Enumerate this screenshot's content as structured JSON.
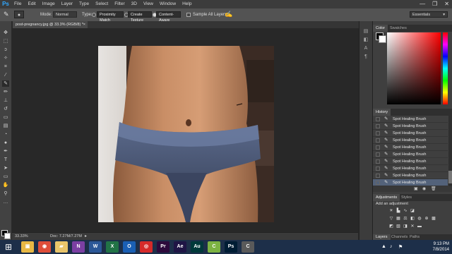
{
  "app": {
    "logo": "Ps"
  },
  "menubar": {
    "items": [
      "File",
      "Edit",
      "Image",
      "Layer",
      "Type",
      "Select",
      "Filter",
      "3D",
      "View",
      "Window",
      "Help"
    ],
    "controls": [
      "—",
      "❐",
      "✕"
    ]
  },
  "options": {
    "mode_label": "Mode:",
    "mode_value": "Normal",
    "type_label": "Type:",
    "btn_proximity": "Proximity Match",
    "btn_texture": "Create Texture",
    "btn_content": "Content-Aware",
    "sample_label": "Sample All Layers",
    "workspace": "Essentials"
  },
  "document": {
    "tab_title": "post-pregnancy.jpg @ 33.3% (RGB/8) *",
    "close": "×"
  },
  "status": {
    "zoom": "33.33%",
    "doc": "Doc: 7.27M/7.27M"
  },
  "color_panel": {
    "tabs": [
      "Color",
      "Swatches"
    ]
  },
  "history_panel": {
    "title": "History",
    "items": [
      "Spot Healing Brush",
      "Spot Healing Brush",
      "Spot Healing Brush",
      "Spot Healing Brush",
      "Spot Healing Brush",
      "Spot Healing Brush",
      "Spot Healing Brush",
      "Spot Healing Brush",
      "Spot Healing Brush",
      "Spot Healing Brush"
    ]
  },
  "adjustments_panel": {
    "tabs": [
      "Adjustments",
      "Styles"
    ],
    "heading": "Add an adjustment"
  },
  "layers_panel": {
    "tabs": [
      "Layers",
      "Channels",
      "Paths"
    ]
  },
  "taskbar": {
    "apps": [
      {
        "name": "explorer",
        "label": "▣",
        "color": "#e8b844"
      },
      {
        "name": "chrome",
        "label": "◉",
        "color": "#de4d39"
      },
      {
        "name": "folder",
        "label": "▰",
        "color": "#e8c46a"
      },
      {
        "name": "onenote",
        "label": "N",
        "color": "#7b3fa3"
      },
      {
        "name": "word",
        "label": "W",
        "color": "#2b5797"
      },
      {
        "name": "excel",
        "label": "X",
        "color": "#217346"
      },
      {
        "name": "outlook",
        "label": "O",
        "color": "#1a5fb4"
      },
      {
        "name": "creative-cloud",
        "label": "◎",
        "color": "#d52a2a"
      },
      {
        "name": "premiere",
        "label": "Pr",
        "color": "#2d0a3c"
      },
      {
        "name": "after-effects",
        "label": "Ae",
        "color": "#1f1545"
      },
      {
        "name": "audition",
        "label": "Au",
        "color": "#00393a"
      },
      {
        "name": "camtasia",
        "label": "C",
        "color": "#7cb342"
      },
      {
        "name": "photoshop",
        "label": "Ps",
        "color": "#001d34"
      },
      {
        "name": "recorder",
        "label": "C",
        "color": "#5a5a5a"
      }
    ],
    "time": "9:13 PM",
    "date": "7/8/2014"
  }
}
